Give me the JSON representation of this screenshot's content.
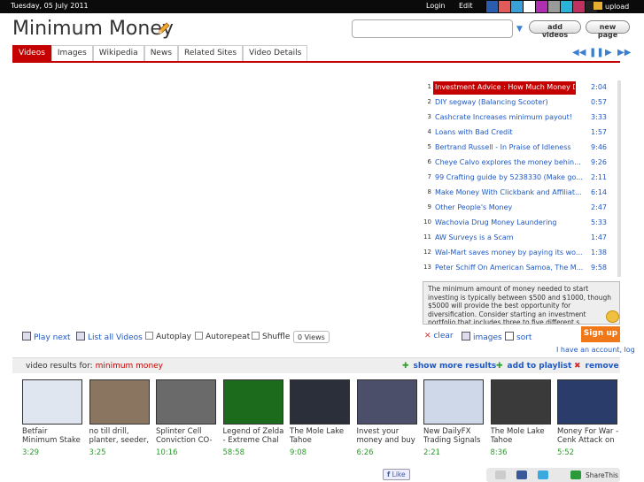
{
  "topbar": {
    "date": "Tuesday, 05 July 2011",
    "login": "Login",
    "edit": "Edit",
    "upload": "upload",
    "swatches": [
      "#2a5db0",
      "#e35a5a",
      "#3aa0d8",
      "#ffffff",
      "#b02fb0",
      "#9a9a9a",
      "#2bb3d6",
      "#c03060",
      "#222222"
    ]
  },
  "header": {
    "title": "Minimum Money",
    "search_value": "",
    "add_videos": "add videos",
    "new_page": "new page"
  },
  "tabs": [
    "Videos",
    "Images",
    "Wikipedia",
    "News",
    "Related Sites",
    "Video Details"
  ],
  "playlist": [
    {
      "n": "1",
      "title": "Investment Advice : How Much Money D...",
      "dur": "2:04",
      "active": true
    },
    {
      "n": "2",
      "title": "DIY segway (Balancing Scooter)",
      "dur": "0:57"
    },
    {
      "n": "3",
      "title": "Cashcrate Increases minimum payout!",
      "dur": "3:33"
    },
    {
      "n": "4",
      "title": "Loans with Bad Credit",
      "dur": "1:57"
    },
    {
      "n": "5",
      "title": "Bertrand Russell - In Praise of Idleness",
      "dur": "9:46"
    },
    {
      "n": "6",
      "title": "Cheye Calvo explores the money behin...",
      "dur": "9:26"
    },
    {
      "n": "7",
      "title": "99 Crafting guide by 5238330 (Make go...",
      "dur": "2:11"
    },
    {
      "n": "8",
      "title": "Make Money With Clickbank and Affiliat...",
      "dur": "6:14"
    },
    {
      "n": "9",
      "title": "Other People's Money",
      "dur": "2:47"
    },
    {
      "n": "10",
      "title": "Wachovia Drug Money Laundering",
      "dur": "5:33"
    },
    {
      "n": "11",
      "title": "AW Surveys is a Scam",
      "dur": "1:47"
    },
    {
      "n": "12",
      "title": "Wal-Mart saves money by paying its wo...",
      "dur": "1:38"
    },
    {
      "n": "13",
      "title": "Peter Schiff On American Samoa, The M...",
      "dur": "9:58"
    }
  ],
  "description": "The minimum amount of money needed to start investing is typically between $500 and $1000, though $5000 will provide the best opportunity for diversification. Consider starting an investment portfolio that includes three to five different s...",
  "controls": {
    "play_next": "Play next",
    "list_all": "List all Videos",
    "autoplay": "Autoplay",
    "autorepeat": "Autorepeat",
    "shuffle": "Shuffle",
    "views": "0 Views",
    "clear": "clear",
    "images": "images",
    "sort": "sort",
    "signup": "Sign up",
    "account": "I have an account, log"
  },
  "results": {
    "label": "video results for:",
    "query": "minimum money",
    "show_more": "show more results",
    "add_playlist": "add to playlist",
    "remove": "remove"
  },
  "videos": [
    {
      "title": "Betfair Minimum Stake",
      "dur": "3:29",
      "color": "#dfe6f0"
    },
    {
      "title": "no till drill, planter, seeder,",
      "dur": "3:25",
      "color": "#8a7660"
    },
    {
      "title": "Splinter Cell Conviction CO-OP on",
      "dur": "10:16",
      "color": "#6a6a6a"
    },
    {
      "title": "Legend of Zelda - Extreme Chal",
      "dur": "58:58",
      "color": "#1c6a1c"
    },
    {
      "title": "The Mole Lake Tahoe",
      "dur": "9:08",
      "color": "#2a2f3a"
    },
    {
      "title": "Invest your money and buy",
      "dur": "6:26",
      "color": "#4b4f6a"
    },
    {
      "title": "New DailyFX Trading Signals",
      "dur": "2:21",
      "color": "#cfd8e8"
    },
    {
      "title": "The Mole Lake Tahoe",
      "dur": "8:36",
      "color": "#3a3a3a"
    },
    {
      "title": "Money For War - Cenk Attack on",
      "dur": "5:52",
      "color": "#2a3d6a"
    }
  ],
  "footer": {
    "like": "Like",
    "share": "ShareThis"
  }
}
